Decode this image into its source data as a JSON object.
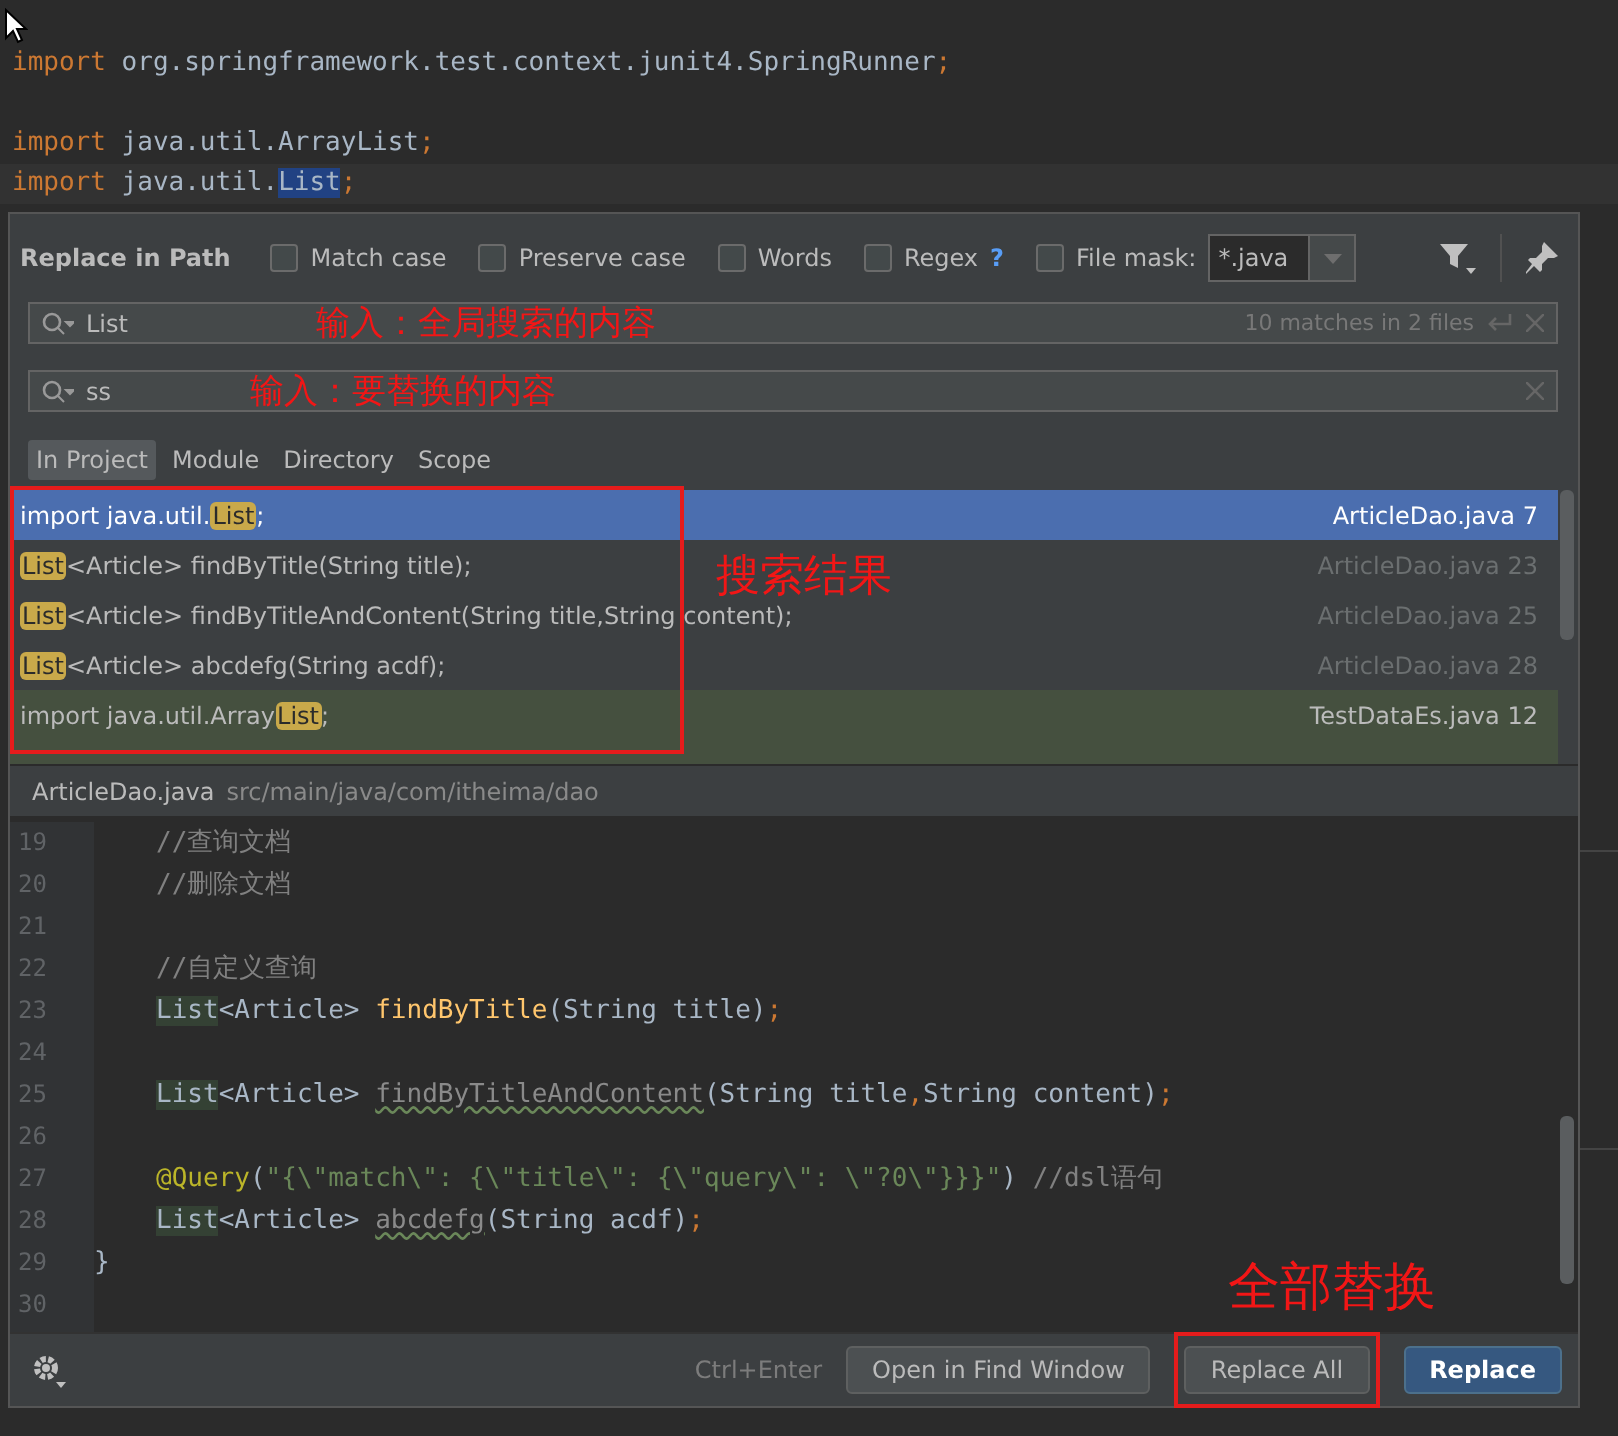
{
  "editor_background": {
    "import_groups": [
      [
        {
          "segments": [
            {
              "t": "import",
              "kind": "keyword"
            },
            {
              "t": " org.springframework.test.context.junit4.SpringRunner",
              "kind": "plain"
            },
            {
              "t": ";",
              "kind": "punct"
            }
          ]
        }
      ],
      [
        {
          "segments": [
            {
              "t": "import",
              "kind": "keyword"
            },
            {
              "t": " java.util.ArrayList",
              "kind": "plain"
            },
            {
              "t": ";",
              "kind": "punct"
            }
          ]
        },
        {
          "segments": [
            {
              "t": "import",
              "kind": "keyword"
            },
            {
              "t": " java.util.",
              "kind": "plain"
            },
            {
              "t": "List",
              "kind": "selection"
            },
            {
              "t": ";",
              "kind": "punct"
            }
          ]
        }
      ]
    ]
  },
  "dialog": {
    "title": "Replace in Path",
    "options": [
      {
        "label": "Match case",
        "checked": false
      },
      {
        "label": "Preserve case",
        "checked": false
      },
      {
        "label": "Words",
        "checked": false
      },
      {
        "label": "Regex",
        "checked": false,
        "help": "?"
      }
    ],
    "file_mask": {
      "label": "File mask:",
      "checked": false,
      "value": "*.java"
    },
    "search": {
      "value": "List",
      "status": "10 matches in 2 files"
    },
    "replace": {
      "value": "ss"
    },
    "scopes": [
      {
        "label": "In Project",
        "selected": true
      },
      {
        "label": "Module",
        "selected": false
      },
      {
        "label": "Directory",
        "selected": false
      },
      {
        "label": "Scope",
        "selected": false
      }
    ],
    "results": [
      {
        "prefix": "import java.util.",
        "match": "List",
        "suffix": ";",
        "file": "ArticleDao.java",
        "line": "7",
        "selected": true,
        "other_file": false
      },
      {
        "match": "List",
        "suffix": "<Article> findByTitle(String title);",
        "file": "ArticleDao.java",
        "line": "23",
        "selected": false,
        "other_file": false
      },
      {
        "match": "List",
        "suffix": "<Article> findByTitleAndContent(String title,String content);",
        "file": "ArticleDao.java",
        "line": "25",
        "selected": false,
        "other_file": false
      },
      {
        "match": "List",
        "suffix": "<Article> abcdefg(String acdf);",
        "file": "ArticleDao.java",
        "line": "28",
        "selected": false,
        "other_file": false
      },
      {
        "prefix": "import java.util.Array",
        "match": "List",
        "suffix": ";",
        "file": "TestDataEs.java",
        "line": "12",
        "selected": false,
        "other_file": true
      }
    ],
    "preview": {
      "file": "ArticleDao.java",
      "path": "src/main/java/com/itheima/dao",
      "lines": [
        {
          "number": "19",
          "indented": true,
          "segments": [
            {
              "t": "//查询文档",
              "kind": "comment"
            }
          ]
        },
        {
          "number": "20",
          "indented": true,
          "segments": [
            {
              "t": "//删除文档",
              "kind": "comment"
            }
          ]
        },
        {
          "number": "21"
        },
        {
          "number": "22",
          "indented": true,
          "segments": [
            {
              "t": "//自定义查询",
              "kind": "comment"
            }
          ]
        },
        {
          "number": "23",
          "indented": true,
          "segments": [
            {
              "t": "List",
              "kind": "match"
            },
            {
              "t": "<Article> ",
              "kind": "plain"
            },
            {
              "t": "findByTitle",
              "kind": "method"
            },
            {
              "t": "(String title)",
              "kind": "plain"
            },
            {
              "t": ";",
              "kind": "punct"
            }
          ]
        },
        {
          "number": "24"
        },
        {
          "number": "25",
          "indented": true,
          "segments": [
            {
              "t": "List",
              "kind": "match"
            },
            {
              "t": "<Article> ",
              "kind": "plain"
            },
            {
              "t": "findByTitleAndContent",
              "kind": "unused"
            },
            {
              "t": "(String title",
              "kind": "plain"
            },
            {
              "t": ",",
              "kind": "punct"
            },
            {
              "t": "String content)",
              "kind": "plain"
            },
            {
              "t": ";",
              "kind": "punct"
            }
          ]
        },
        {
          "number": "26"
        },
        {
          "number": "27",
          "indented": true,
          "segments": [
            {
              "t": "@Query",
              "kind": "annot"
            },
            {
              "t": "(",
              "kind": "plain"
            },
            {
              "t": "\"{\\\"match\\\": {\\\"title\\\": {\\\"query\\\": \\\"?0\\\"}}}\"",
              "kind": "string"
            },
            {
              "t": ") ",
              "kind": "plain"
            },
            {
              "t": "//dsl语句",
              "kind": "comment"
            }
          ]
        },
        {
          "number": "28",
          "indented": true,
          "segments": [
            {
              "t": "List",
              "kind": "match"
            },
            {
              "t": "<Article> ",
              "kind": "plain"
            },
            {
              "t": "abcdefg",
              "kind": "unused"
            },
            {
              "t": "(String acdf)",
              "kind": "plain"
            },
            {
              "t": ";",
              "kind": "punct"
            }
          ]
        },
        {
          "number": "29",
          "indented": false,
          "segments": [
            {
              "t": "}",
              "kind": "plain"
            }
          ]
        },
        {
          "number": "30"
        }
      ]
    },
    "footer": {
      "shortcut": "Ctrl+Enter",
      "buttons": [
        {
          "label": "Open in Find Window",
          "kind": "normal",
          "framed": false
        },
        {
          "label": "Replace All",
          "kind": "normal",
          "framed": true
        },
        {
          "label": "Replace",
          "kind": "primary",
          "framed": false
        }
      ]
    }
  },
  "annotations": [
    {
      "text": "输入：全局搜索的内容",
      "kind": "search"
    },
    {
      "text": "输入：要替换的内容",
      "kind": "replace"
    },
    {
      "text": "搜索结果",
      "kind": "results"
    },
    {
      "text": "全部替换",
      "kind": "replace_all"
    }
  ]
}
